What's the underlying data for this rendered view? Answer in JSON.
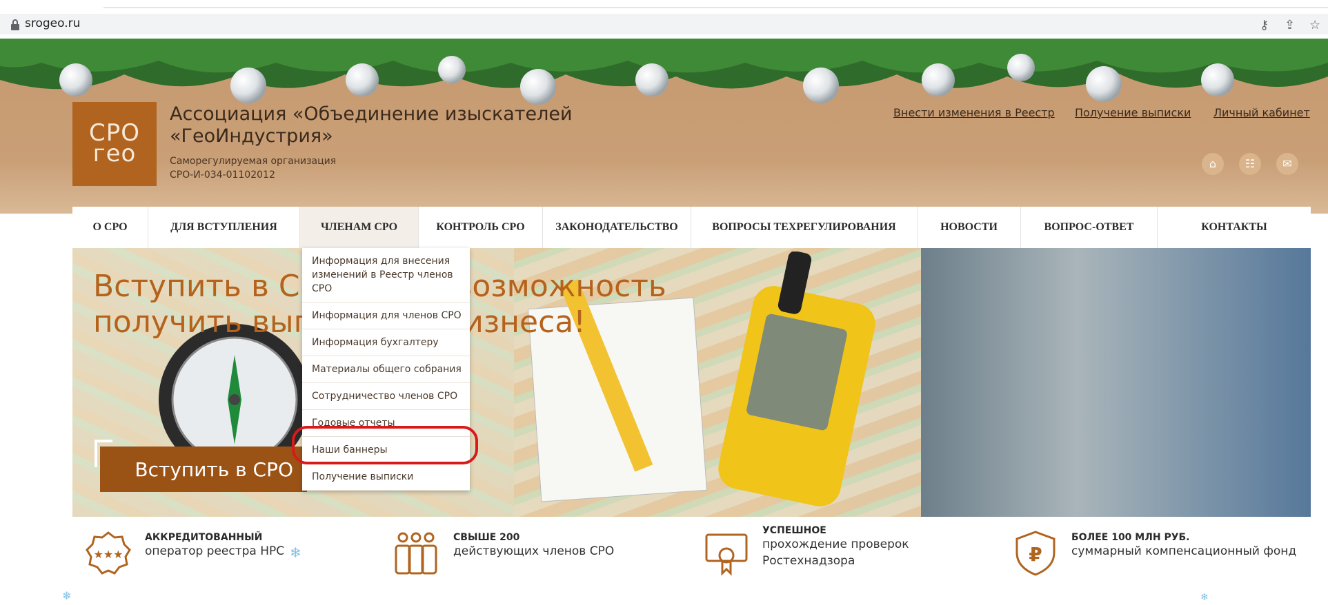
{
  "browser": {
    "url": "srogeo.ru",
    "icons": [
      "lock-icon",
      "key-icon",
      "share-icon",
      "star-icon"
    ]
  },
  "header": {
    "logo_line1": "СРО",
    "logo_line2": "гео",
    "org_title": "Ассоциация «Объединение изыскателей «ГеоИндустрия»",
    "org_subtitle_1": "Саморегулируемая организация",
    "org_subtitle_2": "СРО-И-034-01102012",
    "top_links": [
      "Внести изменения в Реестр",
      "Получение выписки",
      "Личный кабинет"
    ],
    "round_icons": [
      "home-icon",
      "sitemap-icon",
      "mail-icon"
    ]
  },
  "nav": {
    "items": [
      "О СРО",
      "ДЛЯ ВСТУПЛЕНИЯ",
      "ЧЛЕНАМ СРО",
      "КОНТРОЛЬ СРО",
      "ЗАКОНОДАТЕЛЬСТВО",
      "ВОПРОСЫ ТЕХРЕГУЛИРОВАНИЯ",
      "НОВОСТИ",
      "ВОПРОС-ОТВЕТ",
      "КОНТАКТЫ"
    ],
    "active": "ЧЛЕНАМ СРО"
  },
  "banner": {
    "headline_1": "Вступить в СРО — это возможность",
    "headline_2": "получить выгоду для бизнеса!",
    "button": "Вступить в СРО"
  },
  "dropdown": {
    "items": [
      "Информация для внесения изменений в Реестр членов СРО",
      "Информация для членов СРО",
      "Информация бухгалтеру",
      "Материалы общего собрания",
      "Сотрудничество членов СРО",
      "Годовые отчеты",
      "Наши баннеры",
      "Получение выписки"
    ],
    "highlighted": "Годовые отчеты"
  },
  "features": [
    {
      "title": "АККРЕДИТОВАННЫЙ",
      "text": "оператор реестра НРС",
      "icon": "stars-badge-icon"
    },
    {
      "title": "СВЫШЕ 200",
      "text": "действующих членов СРО",
      "icon": "people-icon"
    },
    {
      "title": "УСПЕШНОЕ",
      "text": "прохождение проверок Ростехнадзора",
      "icon": "certificate-icon"
    },
    {
      "title": "БОЛЕЕ 100 МЛН РУБ.",
      "text": "суммарный компенсационный фонд",
      "icon": "ruble-shield-icon"
    }
  ],
  "colors": {
    "header_bg": "#c79a6f",
    "logo_bg": "#b0641f",
    "accent_brown": "#9b5215",
    "highlight_red": "#d81a1a"
  }
}
